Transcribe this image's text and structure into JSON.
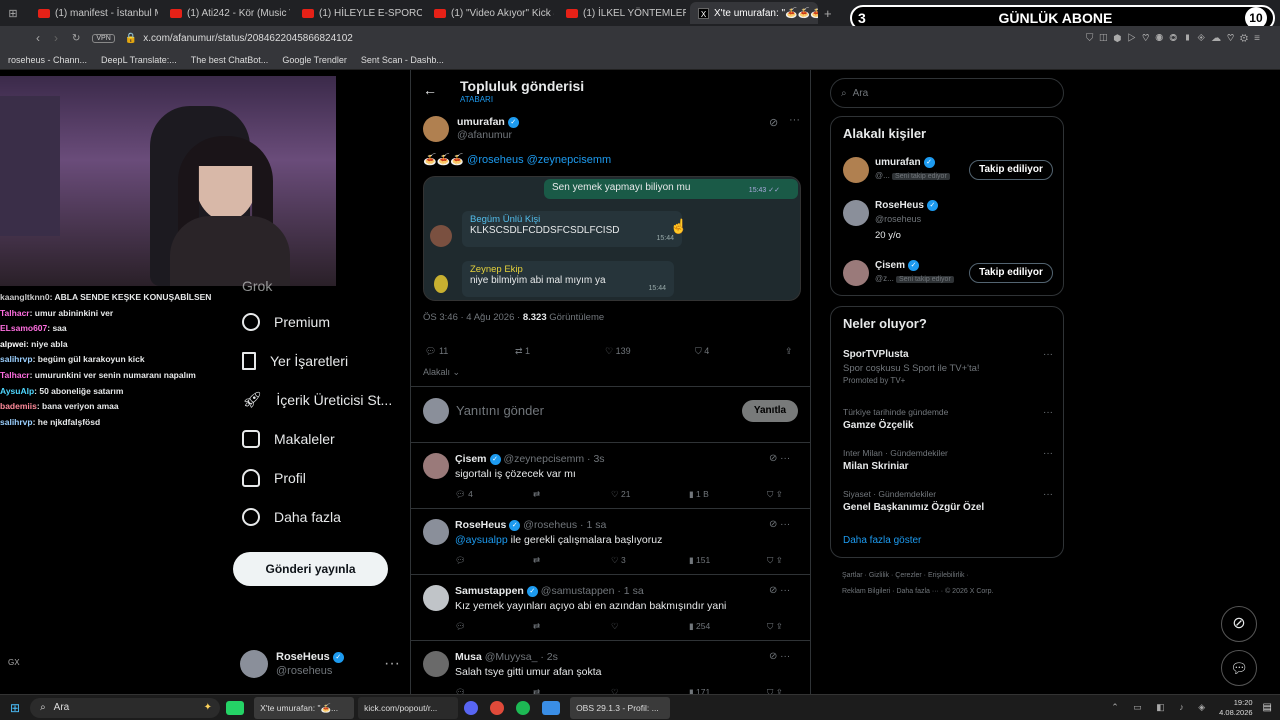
{
  "browser": {
    "tabs": [
      "(1) manifest - İstanbul Manis",
      "(1) Ati242 - Kör (Music Vid",
      "(1) HİLEYLE E-SPORCU OL",
      "(1) \"Video Akıyor\" Kick & T",
      "(1) İLKEL YÖNTEMLER İLE",
      "X'te umurafan: \"🍝🍝🍝\""
    ],
    "url": "x.com/afanumur/status/2084622045866824102",
    "vpn": "VPN",
    "bookmarks": [
      "roseheus - Chann...",
      "DeepL Translate:...",
      "The best ChatBot...",
      "Google Trendler",
      "Sent Scan - Dashb..."
    ]
  },
  "overlay": {
    "sub_left": "3",
    "sub_title": "GÜNLÜK ABONE",
    "sub_right": "10"
  },
  "stream_chat": [
    {
      "user": "kaangltknn0",
      "msg": ": ABLA SENDE KEŞKE KONUŞABİLSEN",
      "color": "#c8c8c8"
    },
    {
      "user": "Talhacr",
      "msg": ": umur abininkini ver",
      "color": "#ff6ee0"
    },
    {
      "user": "ELsamo607",
      "msg": ": saa",
      "color": "#ff6ee0"
    },
    {
      "user": "alpwei",
      "msg": ": niye abla",
      "color": "#ffffff"
    },
    {
      "user": "salihrvp",
      "msg": ": begüm gül karakoyun kick",
      "color": "#9bd0ff"
    },
    {
      "user": "Talhacr",
      "msg": ": umurunkini ver senin numaranı napalım",
      "color": "#ff6ee0"
    },
    {
      "user": "AysuAlp",
      "msg": ": 50 aboneliğe satarım",
      "color": "#4fd8ff"
    },
    {
      "user": "bademiis",
      "msg": ": bana veriyon amaa",
      "color": "#ff8a9a"
    },
    {
      "user": "salihrvp",
      "msg": ": he njkdfalşfösd",
      "color": "#9bd0ff"
    }
  ],
  "sidebar": {
    "items": [
      "Grok",
      "Premium",
      "Yer İşaretleri",
      "İçerik Üreticisi St...",
      "Makaleler",
      "Profil",
      "Daha fazla"
    ],
    "post_button": "Gönderi yayınla",
    "account_name": "RoseHeus",
    "account_handle": "@roseheus",
    "more": "···"
  },
  "post": {
    "header": "Topluluk gönderisi",
    "subheader": "ATABARI",
    "back": "←",
    "author": "umurafan",
    "handle": "@afanumur",
    "text_prefix": "🍝🍝🍝",
    "mentions": "@roseheus @zeynepcisemm",
    "chat": [
      {
        "side": "right",
        "text": "Sen yemek yapmayı biliyon mu",
        "time": "15:43 ✓✓"
      },
      {
        "side": "left",
        "name": "Begüm Ünlü Kişi",
        "text": "KLKSCSDLFCDDSFCSDLFCISD",
        "time": "15:44",
        "name_color": "#53bdeb"
      },
      {
        "side": "left",
        "name": "Zeynep Ekip",
        "text": "niye bilmiyim abi mal mıyım ya",
        "time": "15:44",
        "name_color": "#e5d23b"
      }
    ],
    "meta_time": "ÖS 3:46 · 4 Ağu 2026 · ",
    "views": "8.323",
    "views_label": " Görüntüleme",
    "stats": {
      "replies": "11",
      "reposts": "1",
      "likes": "139",
      "bookmarks": "4"
    },
    "sort": "Alakalı",
    "reply_placeholder": "Yanıtını gönder",
    "reply_button": "Yanıtla"
  },
  "replies": [
    {
      "name": "Çisem",
      "handle": "@zeynepcisemm · 3s",
      "text": "sigortalı iş çözecek var mı",
      "mention": "",
      "stats": [
        "4",
        "",
        "21",
        "1 B"
      ]
    },
    {
      "name": "RoseHeus",
      "handle": "@roseheus · 1 sa",
      "text": " ile gerekli çalışmalara başlıyoruz",
      "mention": "@aysualpp",
      "stats": [
        "",
        "",
        "3",
        "151"
      ]
    },
    {
      "name": "Samustappen",
      "handle": "@samustappen · 1 sa",
      "text": "Kız yemek yayınları açıyo abi en azından bakmışındır yani",
      "mention": "",
      "stats": [
        "",
        "",
        "",
        "254"
      ]
    },
    {
      "name": "Musa",
      "handle": "@Muyysa_ · 2s",
      "text": "Salah tsye gitti umur afan şokta",
      "mention": "",
      "stats": [
        "",
        "",
        "",
        "171"
      ]
    }
  ],
  "right": {
    "search_placeholder": "Ara",
    "people_title": "Alakalı kişiler",
    "people": [
      {
        "name": "umurafan",
        "handle": "@...",
        "tag": "Seni takip ediyor",
        "button": "Takip ediliyor",
        "bio": ""
      },
      {
        "name": "RoseHeus",
        "handle": "@roseheus",
        "tag": "",
        "button": "",
        "bio": "20 y/o"
      },
      {
        "name": "Çisem",
        "handle": "@z...",
        "tag": "Seni takip ediyor",
        "button": "Takip ediliyor",
        "bio": ""
      }
    ],
    "trends_title": "Neler oluyor?",
    "trends": [
      {
        "cat": "",
        "title": "SporTVPlusta",
        "desc": "Spor coşkusu S Sport ile TV+'ta!",
        "promo": "Promoted by TV+"
      },
      {
        "cat": "Türkiye tarihinde gündemde",
        "title": "Gamze Özçelik",
        "desc": "",
        "promo": ""
      },
      {
        "cat": "Inter Milan · Gündemdekiler",
        "title": "Milan Skriniar",
        "desc": "",
        "promo": ""
      },
      {
        "cat": "Siyaset · Gündemdekiler",
        "title": "Genel Başkanımız Özgür Özel",
        "desc": "",
        "promo": ""
      }
    ],
    "show_more": "Daha fazla göster",
    "footer1": "Şartlar  ·  Gizlilik  ·  Çerezler  ·  Erişilebilirlik  ·",
    "footer2": "Reklam Bilgileri  ·  Daha fazla ···  ·  © 2026 X Corp."
  },
  "taskbar": {
    "search": "Ara",
    "apps": [
      "X'te umurafan: \"🍝...",
      "kick.com/popout/r...",
      "OBS 29.1.3 - Profil: ..."
    ],
    "time": "19:20",
    "date": "4.08.2026"
  }
}
